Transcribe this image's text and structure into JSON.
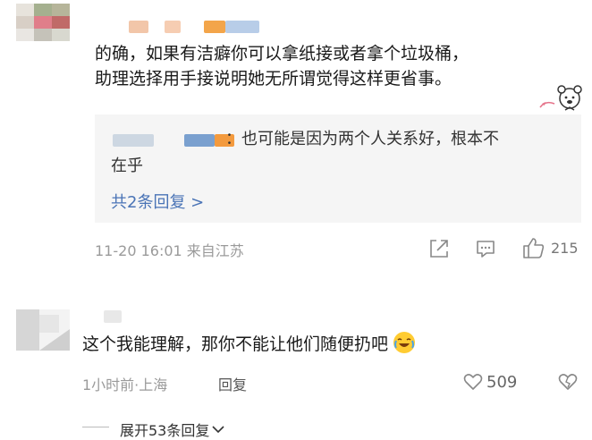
{
  "comment1": {
    "text_line1": "的确，如果有洁癖你可以拿纸接或者拿个垃圾桶，",
    "text_line2": "助理选择用手接说明她无所谓觉得这样更省事。",
    "reply": {
      "text_line1": "：也可能是因为两个人关系好，根本不",
      "text_line2": "在乎",
      "more_label": "共2条回复 >"
    },
    "meta": "11-20 16:01 来自江苏",
    "like_count": "215"
  },
  "comment2": {
    "text": "这个我能理解，那你不能让他们随便扔吧",
    "meta": "1小时前·上海",
    "reply_label": "回复",
    "like_count": "509"
  },
  "expand_label": "展开53条回复",
  "colors": {
    "accent_blue": "#4a74b6",
    "meta_gray": "#9a9a9a",
    "reply_bg": "#f5f5f5"
  },
  "icons": [
    "share-icon",
    "comment-icon",
    "thumbs-up-icon",
    "heart-icon",
    "broken-heart-icon",
    "chevron-down-icon",
    "laugh-cry-emoji"
  ]
}
